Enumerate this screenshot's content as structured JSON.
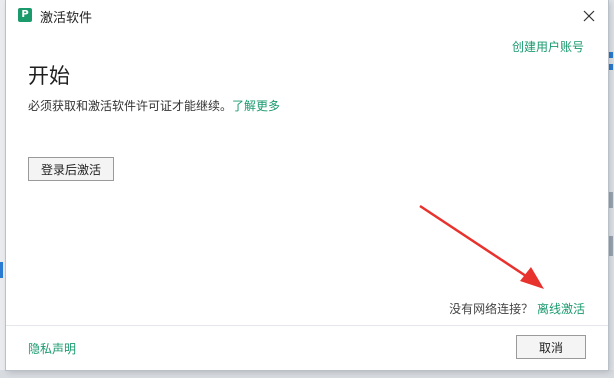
{
  "window": {
    "title": "激活软件",
    "app_icon_letter": "P",
    "close_icon": "close-icon"
  },
  "header": {
    "create_account_link": "创建用户账号"
  },
  "main": {
    "heading": "开始",
    "description": "必须获取和激活软件许可证才能继续。",
    "learn_more_link": "了解更多",
    "login_button": "登录后激活",
    "no_network_text": "没有网络连接？",
    "offline_activation_link": "离线激活"
  },
  "footer": {
    "privacy_link": "隐私声明",
    "cancel_button": "取消"
  },
  "colors": {
    "accent": "#1a9a6e",
    "annotation_arrow": "#e8322d"
  }
}
